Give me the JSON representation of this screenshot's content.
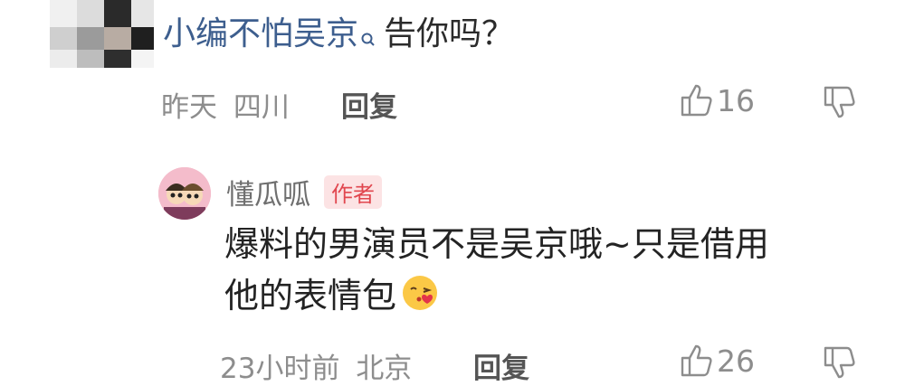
{
  "comment": {
    "mention": "小编不怕吴京",
    "text": "告你吗？",
    "meta_time": "昨天",
    "meta_location": "四川",
    "reply_label": "回复",
    "like_count": "16"
  },
  "reply": {
    "username": "懂瓜呱",
    "author_badge": "作者",
    "text_line1": "爆料的男演员不是吴京哦~只是借用",
    "text_line2": "他的表情包",
    "emoji": "😘",
    "meta_time": "23小时前",
    "meta_location": "北京",
    "reply_label": "回复",
    "like_count": "26"
  },
  "colors": {
    "mention": "#3d5e8e",
    "badge_bg": "#fce3e4",
    "badge_text": "#e1474f",
    "meta": "#8d8d8d"
  }
}
